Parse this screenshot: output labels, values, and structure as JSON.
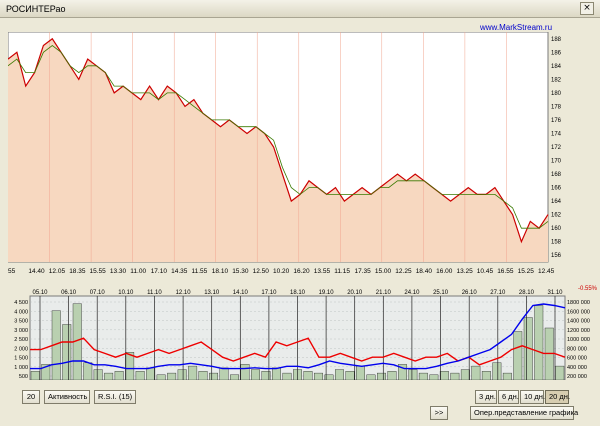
{
  "window": {
    "title": "РОСИНТЕРао",
    "close_label": "×"
  },
  "brand": "www.MarkStream.ru",
  "price_chart": {
    "y_ticks": [
      "188",
      "186",
      "184",
      "182",
      "180",
      "178",
      "176",
      "174",
      "172",
      "170",
      "168",
      "166",
      "164",
      "162",
      "160",
      "158",
      "156"
    ],
    "ylim": [
      155,
      189
    ],
    "x_ticks": [
      "55",
      "14.40",
      "12.05",
      "18.35",
      "15.55",
      "13.30",
      "11.00",
      "17.10",
      "14.35",
      "11.55",
      "18.10",
      "15.30",
      "12.50",
      "10.20",
      "16.20",
      "13.55",
      "11.15",
      "17.35",
      "15.00",
      "12.25",
      "18.40",
      "16.00",
      "13.25",
      "10.45",
      "16.55",
      "15.25",
      "12.45"
    ],
    "price": [
      185,
      186,
      181,
      183,
      187,
      188,
      186,
      184,
      182,
      185,
      184,
      183,
      180,
      181,
      180,
      179,
      181,
      179,
      181,
      180,
      178,
      179,
      177,
      176,
      175,
      176,
      175,
      174,
      175,
      174,
      172,
      168,
      164,
      165,
      167,
      166,
      165,
      166,
      164,
      165,
      166,
      165,
      166,
      167,
      168,
      167,
      168,
      167,
      166,
      165,
      164,
      165,
      166,
      165,
      165,
      166,
      164,
      162,
      158,
      161,
      160,
      162
    ],
    "ma": [
      184,
      185,
      183,
      183,
      186,
      187,
      186,
      184,
      183,
      184,
      184,
      183,
      181,
      181,
      180,
      180,
      180,
      179,
      180,
      180,
      179,
      178,
      177,
      176,
      176,
      176,
      175,
      175,
      175,
      174,
      173,
      169,
      166,
      165,
      166,
      166,
      165,
      165,
      165,
      165,
      165,
      165,
      166,
      166,
      167,
      167,
      167,
      167,
      166,
      165,
      165,
      165,
      165,
      165,
      165,
      165,
      164,
      163,
      160,
      160,
      160,
      161
    ]
  },
  "volume_chart": {
    "change_label": "-0.55%",
    "dates": [
      "05.10",
      "06.10",
      "07.10",
      "10.10",
      "11.10",
      "12.10",
      "13.10",
      "14.10",
      "17.10",
      "18.10",
      "19.10",
      "20.10",
      "21.10",
      "24.10",
      "25.10",
      "26.10",
      "27.10",
      "28.10",
      "31.10"
    ],
    "left_ticks": [
      "4 500",
      "4 000",
      "3 500",
      "3 000",
      "2 500",
      "2 000",
      "1 500",
      "1 000",
      "500"
    ],
    "right_ticks": [
      "1800 000",
      "1600 000",
      "1400 000",
      "1200 000",
      "1000 000",
      "800 000",
      "600 000",
      "400 000",
      "200 000"
    ],
    "volume": [
      0.5,
      0.9,
      4.0,
      3.2,
      4.4,
      1.0,
      0.6,
      0.4,
      0.5,
      1.6,
      0.5,
      0.7,
      0.3,
      0.4,
      0.6,
      0.8,
      0.5,
      0.4,
      0.7,
      0.3,
      0.9,
      0.6,
      0.5,
      0.7,
      0.4,
      0.6,
      0.5,
      0.4,
      0.3,
      0.6,
      0.5,
      0.8,
      0.3,
      0.4,
      0.5,
      0.9,
      0.6,
      0.4,
      0.3,
      0.5,
      0.4,
      0.6,
      0.8,
      0.5,
      1.0,
      0.4,
      2.8,
      3.6,
      4.3,
      3.0,
      0.8
    ],
    "red_line": [
      0.4,
      0.4,
      0.45,
      0.5,
      0.5,
      0.55,
      0.4,
      0.35,
      0.3,
      0.35,
      0.3,
      0.35,
      0.4,
      0.35,
      0.4,
      0.45,
      0.5,
      0.4,
      0.3,
      0.25,
      0.3,
      0.35,
      0.3,
      0.5,
      0.45,
      0.5,
      0.55,
      0.3,
      0.3,
      0.35,
      0.3,
      0.25,
      0.3,
      0.3,
      0.35,
      0.3,
      0.25,
      0.3,
      0.3,
      0.35,
      0.25,
      0.3,
      0.2,
      0.25,
      0.3,
      0.4,
      0.45,
      0.4,
      0.35,
      0.35,
      0.3
    ],
    "blue_line": [
      0.15,
      0.15,
      0.2,
      0.22,
      0.25,
      0.25,
      0.2,
      0.2,
      0.18,
      0.15,
      0.15,
      0.15,
      0.18,
      0.2,
      0.2,
      0.22,
      0.2,
      0.18,
      0.15,
      0.15,
      0.15,
      0.16,
      0.15,
      0.15,
      0.18,
      0.18,
      0.16,
      0.2,
      0.25,
      0.22,
      0.2,
      0.18,
      0.2,
      0.22,
      0.2,
      0.15,
      0.15,
      0.15,
      0.18,
      0.22,
      0.25,
      0.3,
      0.35,
      0.4,
      0.5,
      0.6,
      0.8,
      0.98,
      1.0,
      0.98,
      0.95
    ]
  },
  "controls": {
    "period": "20",
    "activity": "Активность",
    "rsi": "R.S.I. (15)",
    "days3": "3 дн.",
    "days6": "6 дн.",
    "days10": "10 дн.",
    "days20": "20 дн.",
    "next": ">>",
    "representation": "Опер.представление графика"
  },
  "colors": {
    "price_fill": "#f7d8c0",
    "price_line": "#cc0000",
    "ma_line": "#3a7a00",
    "volume_bar": "#b9d0b0",
    "blue": "#0000ee",
    "red": "#ee0000"
  }
}
